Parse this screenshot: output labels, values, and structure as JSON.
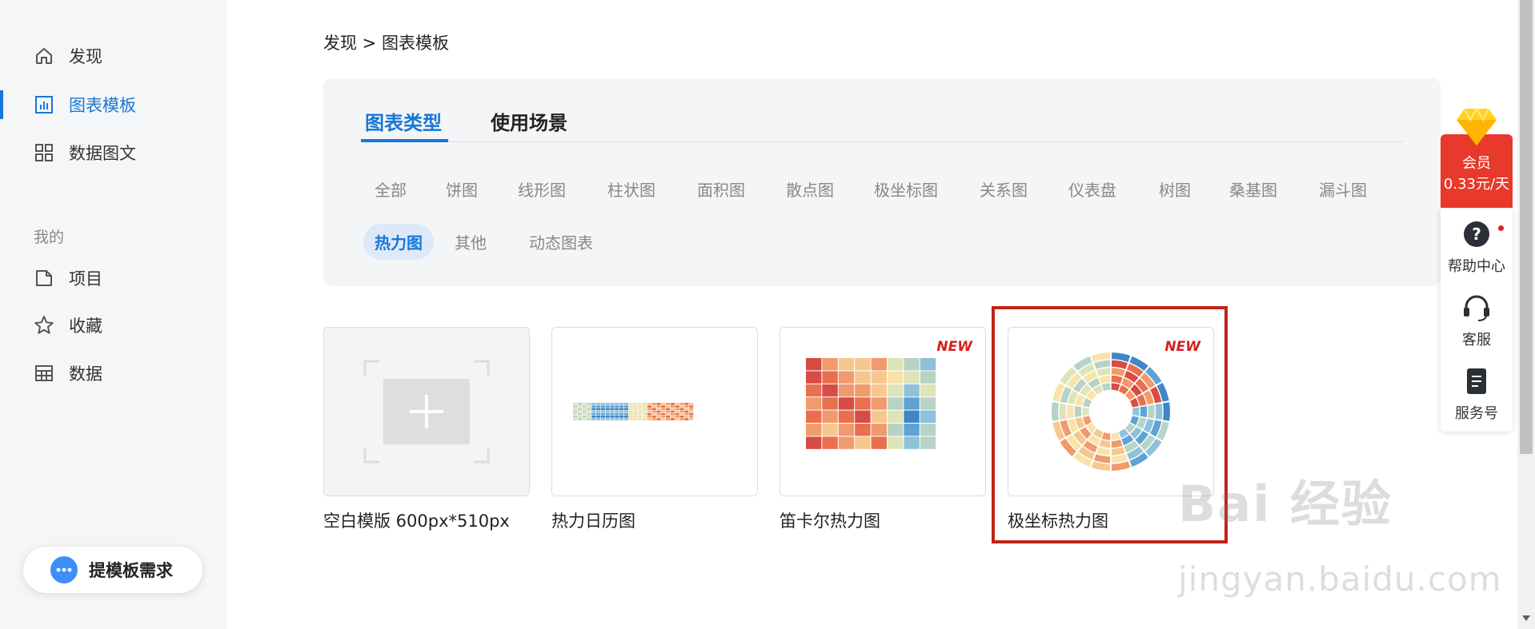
{
  "breadcrumb": "发现 > 图表模板",
  "sidebar": {
    "nav": [
      {
        "label": "发现",
        "icon": "home-icon"
      },
      {
        "label": "图表模板",
        "icon": "chart-icon"
      },
      {
        "label": "数据图文",
        "icon": "grid-icon"
      }
    ],
    "section_label": "我的",
    "my": [
      {
        "label": "项目",
        "icon": "folder-icon"
      },
      {
        "label": "收藏",
        "icon": "star-icon"
      },
      {
        "label": "数据",
        "icon": "table-icon"
      }
    ],
    "request_button": "提模板需求"
  },
  "tabs": [
    "图表类型",
    "使用场景"
  ],
  "chips": [
    "全部",
    "饼图",
    "线形图",
    "柱状图",
    "面积图",
    "散点图",
    "极坐标图",
    "关系图",
    "仪表盘",
    "树图",
    "桑基图",
    "漏斗图",
    "热力图",
    "其他",
    "动态图表"
  ],
  "active_chip": "热力图",
  "cards": [
    {
      "label": "空白模版 600px*510px",
      "badge": ""
    },
    {
      "label": "热力日历图",
      "badge": ""
    },
    {
      "label": "笛卡尔热力图",
      "badge": "NEW"
    },
    {
      "label": "极坐标热力图",
      "badge": "NEW"
    }
  ],
  "right_panel": {
    "vip_line1": "会员",
    "vip_line2": "0.33元/天",
    "help": "帮助中心",
    "service": "客服",
    "account": "服务号"
  },
  "watermark": {
    "main": "Bai 经验",
    "sub": "jingyan.baidu.com"
  },
  "colors": {
    "accent": "#1677d9",
    "vip": "#e8392c",
    "highlight": "#c02418"
  }
}
